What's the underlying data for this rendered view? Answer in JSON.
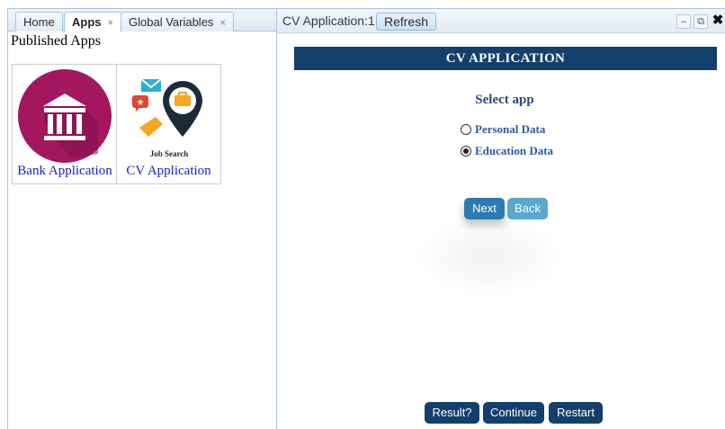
{
  "left_panel": {
    "tabs": [
      {
        "label": "Home",
        "closable": false,
        "active": false
      },
      {
        "label": "Apps",
        "closable": true,
        "active": true
      },
      {
        "label": "Global Variables",
        "closable": true,
        "active": false
      }
    ],
    "close_glyph": "×",
    "published_title": "Published Apps",
    "apps": [
      {
        "label": "Bank Application",
        "icon": "bank-icon",
        "icon_color": "#a3175f"
      },
      {
        "label": "CV Application",
        "icon": "job-search-icon",
        "icon_text": "Job Search"
      }
    ]
  },
  "window": {
    "title": "CV Application:1",
    "refresh_label": "Refresh",
    "minimize_glyph": "–",
    "popout_glyph": "⧉",
    "close_glyph": "✖"
  },
  "cv_app": {
    "banner": "CV APPLICATION",
    "select_label": "Select app",
    "options": [
      {
        "label": "Personal Data",
        "checked": false
      },
      {
        "label": "Education Data",
        "checked": true
      }
    ],
    "next_label": "Next",
    "back_label": "Back",
    "result_label": "Result?",
    "continue_label": "Continue",
    "restart_label": "Restart"
  },
  "colors": {
    "banner": "#123f6b",
    "next_button": "#2c7bb0",
    "back_button": "#5aa8cf",
    "bottom_buttons": "#123f6b",
    "link_text": "#1a1ad6"
  }
}
